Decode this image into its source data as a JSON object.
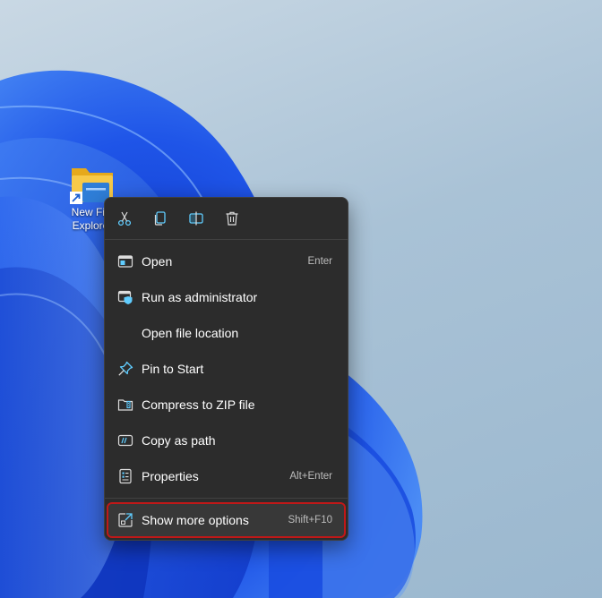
{
  "desktop": {
    "icon": {
      "label": "New File\nExplorer",
      "icon_name": "folder-shortcut-icon"
    }
  },
  "context_menu": {
    "toolbar": [
      {
        "name": "cut",
        "icon": "scissors-icon"
      },
      {
        "name": "copy",
        "icon": "copy-icon"
      },
      {
        "name": "rename",
        "icon": "rename-icon"
      },
      {
        "name": "delete",
        "icon": "trash-icon"
      }
    ],
    "items": [
      {
        "label": "Open",
        "shortcut": "Enter",
        "icon": "open-window-icon"
      },
      {
        "label": "Run as administrator",
        "shortcut": "",
        "icon": "shield-icon"
      },
      {
        "label": "Open file location",
        "shortcut": "",
        "icon": ""
      },
      {
        "label": "Pin to Start",
        "shortcut": "",
        "icon": "pin-icon"
      },
      {
        "label": "Compress to ZIP file",
        "shortcut": "",
        "icon": "zip-icon"
      },
      {
        "label": "Copy as path",
        "shortcut": "",
        "icon": "copy-path-icon"
      },
      {
        "label": "Properties",
        "shortcut": "Alt+Enter",
        "icon": "properties-icon"
      }
    ],
    "more": {
      "label": "Show more options",
      "shortcut": "Shift+F10",
      "icon": "more-options-icon"
    }
  },
  "colors": {
    "menu_bg": "#2c2c2c",
    "accent": "#60cdff",
    "highlight_border": "#c01818"
  }
}
